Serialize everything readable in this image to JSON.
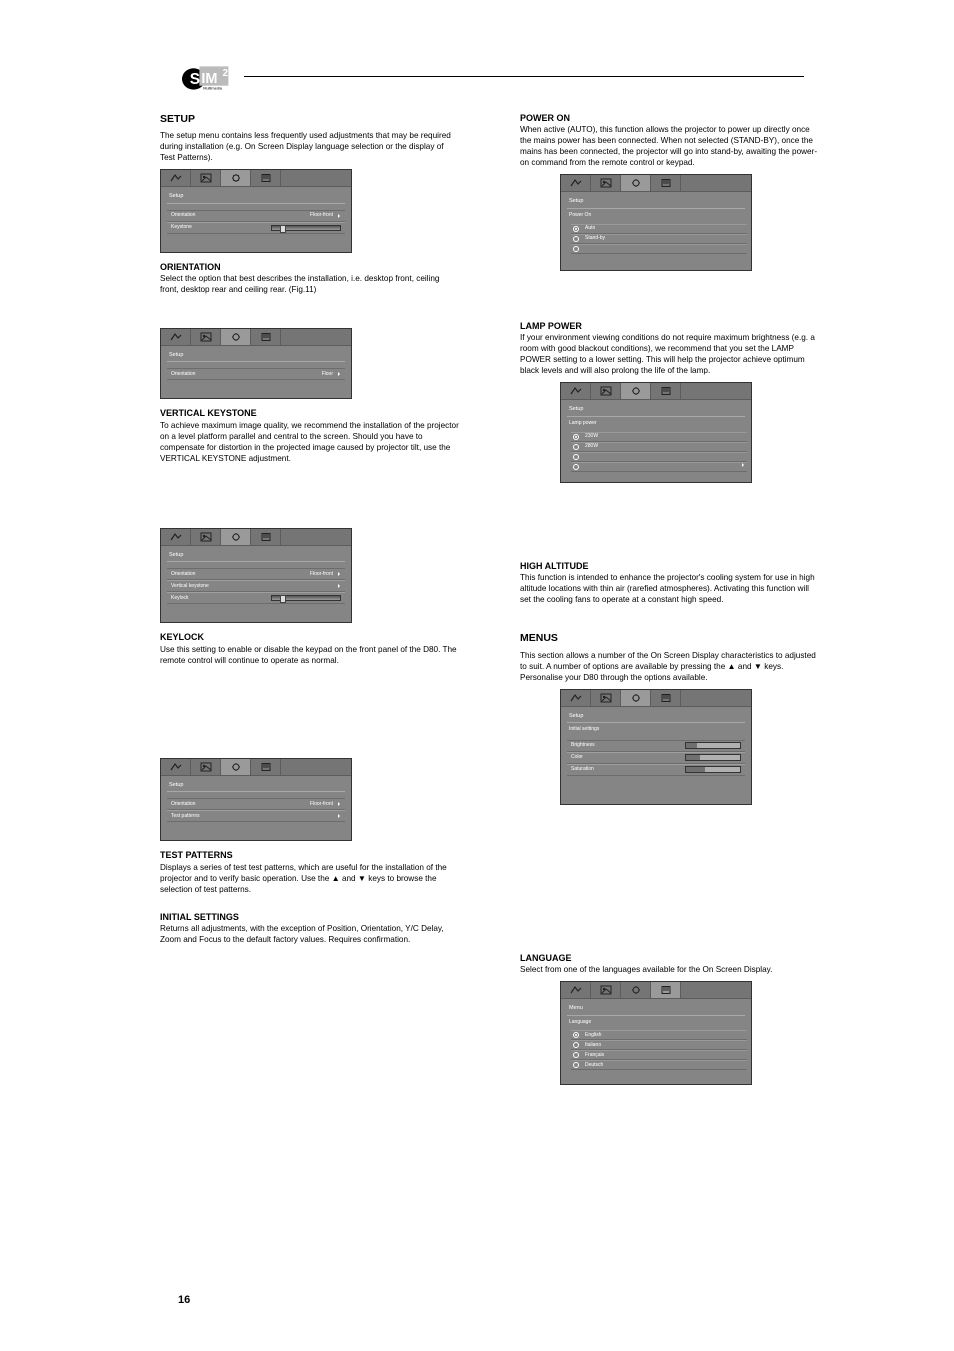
{
  "page_number": "16",
  "section": {
    "heading": "SETUP",
    "intro": "The setup menu contains less frequently used adjustments that may be required during installation (e.g. On Screen Display language selection or the display of Test Patterns)."
  },
  "osd_common": {
    "tabs": [
      "picture",
      "image",
      "setup",
      "menu"
    ]
  },
  "panels": {
    "p1": {
      "title": "Setup",
      "rows": [
        {
          "label": "Orientation",
          "value": "Floor-front"
        },
        {
          "label": "Keystone",
          "value": "",
          "slider": true
        }
      ]
    },
    "p2": {
      "title": "Setup",
      "rows": [
        {
          "label": "Orientation",
          "value": "Floor"
        }
      ]
    },
    "p3": {
      "title": "Setup",
      "rows": [
        {
          "label": "Orientation",
          "value": "Floor-front"
        },
        {
          "label": "Vertical keystone",
          "value": ""
        },
        {
          "label": "Keylock",
          "value": "",
          "slider": true
        }
      ]
    },
    "p4": {
      "title": "Setup",
      "rows": [
        {
          "label": "Orientation",
          "value": "Floor-front"
        },
        {
          "label": "Test patterns",
          "value": ""
        }
      ]
    },
    "p5": {
      "title": "Setup",
      "subhead": "Power On",
      "radios": [
        {
          "label": "Auto",
          "on": true
        },
        {
          "label": "Stand-by",
          "on": false
        },
        {
          "label": "",
          "on": false
        }
      ]
    },
    "p6": {
      "title": "Setup",
      "subhead": "Lamp power",
      "radios": [
        {
          "label": "230W",
          "on": true
        },
        {
          "label": "280W",
          "on": false
        },
        {
          "label": "",
          "on": false
        },
        {
          "label": "",
          "on": false
        }
      ]
    },
    "p7": {
      "title": "Setup",
      "subhead": "Initial settings",
      "rows": [
        {
          "label": "Brightness",
          "fill": 0.2
        },
        {
          "label": "Color",
          "fill": 0.25
        },
        {
          "label": "Saturation",
          "fill": 0.35
        }
      ]
    },
    "p8": {
      "title": "Menu",
      "subhead": "Language",
      "radios": [
        {
          "label": "English",
          "on": true
        },
        {
          "label": "Italiano",
          "on": false
        },
        {
          "label": "Français",
          "on": false
        },
        {
          "label": "Deutsch",
          "on": false
        }
      ]
    }
  },
  "text": {
    "orientation": {
      "h": "ORIENTATION",
      "p": "Select the option that best describes the installation, i.e. desktop front, ceiling front, desktop rear and ceiling rear. (Fig.11)"
    },
    "vkeystone": {
      "h": "VERTICAL KEYSTONE",
      "p": "To achieve maximum image quality, we recommend the installation of the projector on a level platform parallel and central to the screen. Should you have to compensate for distortion in the projected image caused by projector tilt, use the VERTICAL KEYSTONE adjustment."
    },
    "keylock": {
      "h": "KEYLOCK",
      "p": "Use this setting to enable or disable the keypad on the front panel of the D80. The remote control will continue to operate as normal."
    },
    "testpatterns": {
      "h": "TEST PATTERNS",
      "p": "Displays a series of test test patterns, which are useful for the installation of the projector and to verify basic operation. Use the ▲ and ▼ keys to browse the selection of test patterns."
    },
    "initial": {
      "h": "INITIAL SETTINGS",
      "p": "Returns all adjustments, with the exception of Position, Orientation, Y/C Delay, Zoom and Focus to the default factory values. Requires confirmation."
    },
    "poweron": {
      "h": "POWER ON",
      "p": "When active (AUTO), this function allows the projector to power up directly once the mains power has been connected. When not selected (STAND-BY), once the mains has been connected, the projector will go into stand-by, awaiting the power-on command from the remote control or keypad."
    },
    "lamp": {
      "h": "LAMP POWER",
      "p": "If your environment viewing conditions do not require maximum brightness (e.g. a room with good blackout conditions), we recommend that you set the LAMP POWER setting to a lower setting. This will help the projector achieve optimum black levels and will also prolong the life of the lamp."
    },
    "altitude": {
      "h": "HIGH ALTITUDE",
      "p": "This function is intended to enhance the projector's cooling system for use in high altitude locations with thin air (rarefied atmospheres). Activating this function will set the cooling fans to operate at a constant high speed."
    },
    "menus": {
      "h": "MENUS",
      "p": "This section allows a number of the On Screen Display characteristics to adjusted to suit. A number of options are available by pressing the ▲ and ▼ keys. Personalise your D80 through the options available."
    },
    "language": {
      "h": "LANGUAGE",
      "p": "Select from one of the languages available for the On Screen Display."
    }
  }
}
